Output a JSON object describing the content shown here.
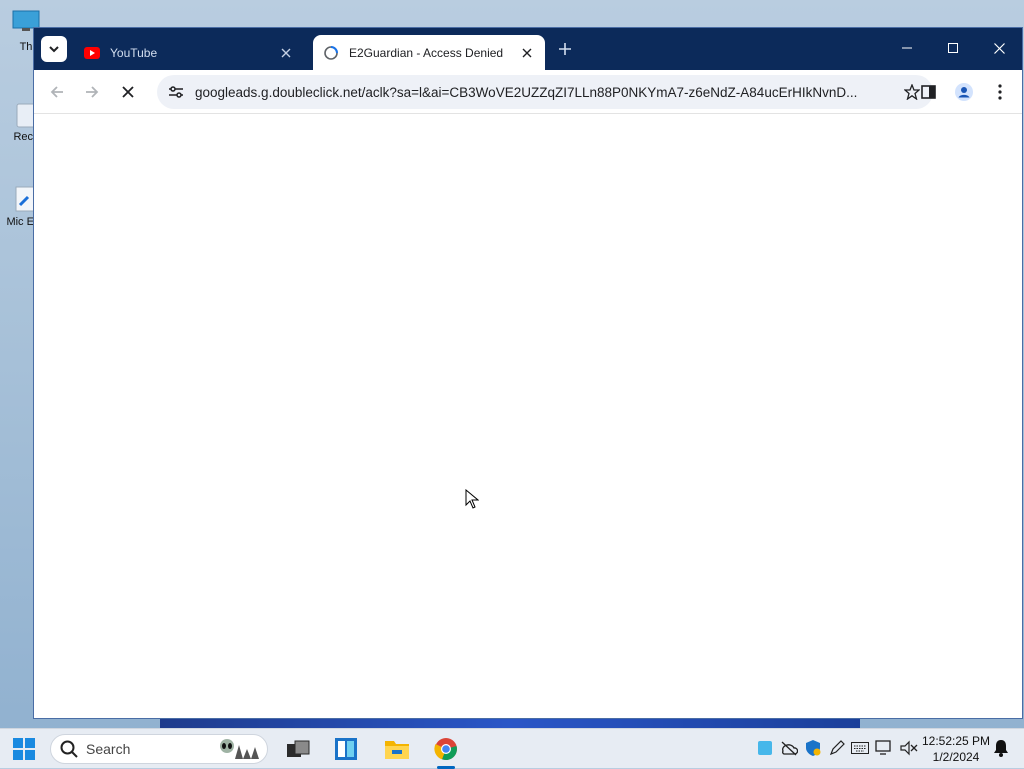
{
  "desktop": {
    "icons": [
      {
        "label": "Th",
        "icon": "monitor-icon"
      },
      {
        "label": "Recy",
        "icon": "recycle-bin-icon"
      },
      {
        "label": "Mic Eve",
        "icon": "shortcut-icon"
      }
    ]
  },
  "browser": {
    "tabs": [
      {
        "title": "YouTube",
        "icon": "youtube-icon",
        "active": false
      },
      {
        "title": "E2Guardian - Access Denied",
        "icon": "loading-globe-icon",
        "active": true
      }
    ],
    "url": "googleads.g.doubleclick.net/aclk?sa=l&ai=CB3WoVE2UZZqZI7LLn88P0NKYmA7-z6eNdZ-A84ucErHIkNvnD...",
    "loading": true,
    "colors": {
      "tabstrip": "#0c2a5a",
      "omnibox": "#eef1f7"
    }
  },
  "taskbar": {
    "search_placeholder": "Search",
    "apps": [
      "start-icon",
      "task-view-icon",
      "widgets-icon",
      "file-explorer-icon",
      "chrome-icon"
    ],
    "tray": [
      "onedrive-icon",
      "network-off-icon",
      "defender-icon",
      "pen-icon",
      "keyboard-icon",
      "display-icon",
      "volume-mute-icon",
      "notification-bell-icon"
    ],
    "time": "12:52:25 PM",
    "date": "1/2/2024"
  }
}
